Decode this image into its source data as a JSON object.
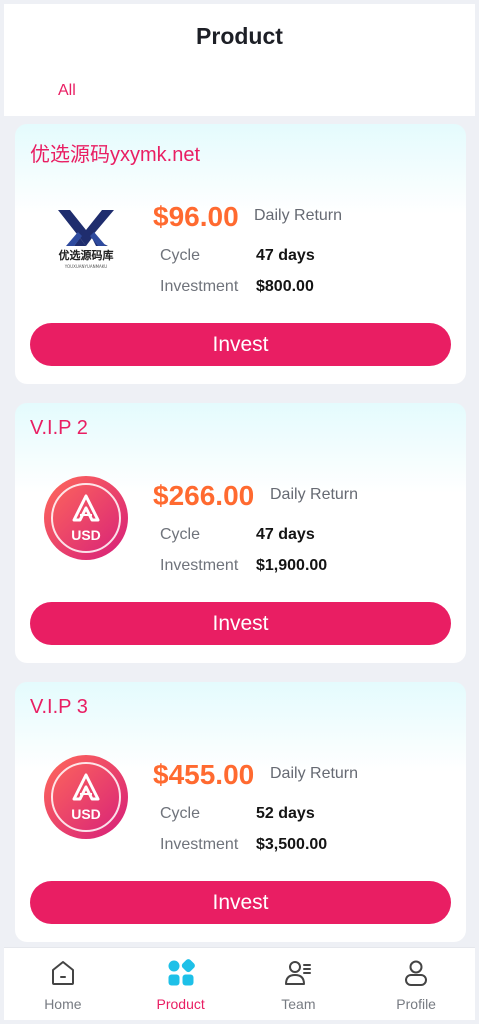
{
  "header": {
    "title": "Product",
    "tab_all": "All"
  },
  "products": [
    {
      "name": "优选源码yxymk.net",
      "price": "$96.00",
      "daily_label": "Daily Return",
      "cycle_label": "Cycle",
      "cycle_value": "47 days",
      "investment_label": "Investment",
      "investment_value": "$800.00",
      "button_label": "Invest",
      "logo": {
        "type": "yxymk",
        "text": "优选源码库",
        "subtext": "YOUXUANYUANMAKU"
      }
    },
    {
      "name": "V.I.P 2",
      "price": "$266.00",
      "daily_label": "Daily Return",
      "cycle_label": "Cycle",
      "cycle_value": "47 days",
      "investment_label": "Investment",
      "investment_value": "$1,900.00",
      "button_label": "Invest",
      "logo": {
        "type": "usd-coin",
        "text": "USD"
      }
    },
    {
      "name": "V.I.P 3",
      "price": "$455.00",
      "daily_label": "Daily Return",
      "cycle_label": "Cycle",
      "cycle_value": "52 days",
      "investment_label": "Investment",
      "investment_value": "$3,500.00",
      "button_label": "Invest",
      "logo": {
        "type": "usd-coin",
        "text": "USD"
      }
    }
  ],
  "nav": [
    {
      "label": "Home",
      "icon": "home-icon",
      "active": false
    },
    {
      "label": "Product",
      "icon": "grid-icon",
      "active": true
    },
    {
      "label": "Team",
      "icon": "team-icon",
      "active": false
    },
    {
      "label": "Profile",
      "icon": "user-icon",
      "active": false
    }
  ],
  "colors": {
    "accent": "#e91e63",
    "price": "#ff6a30",
    "active_icon": "#1ec0e8"
  }
}
